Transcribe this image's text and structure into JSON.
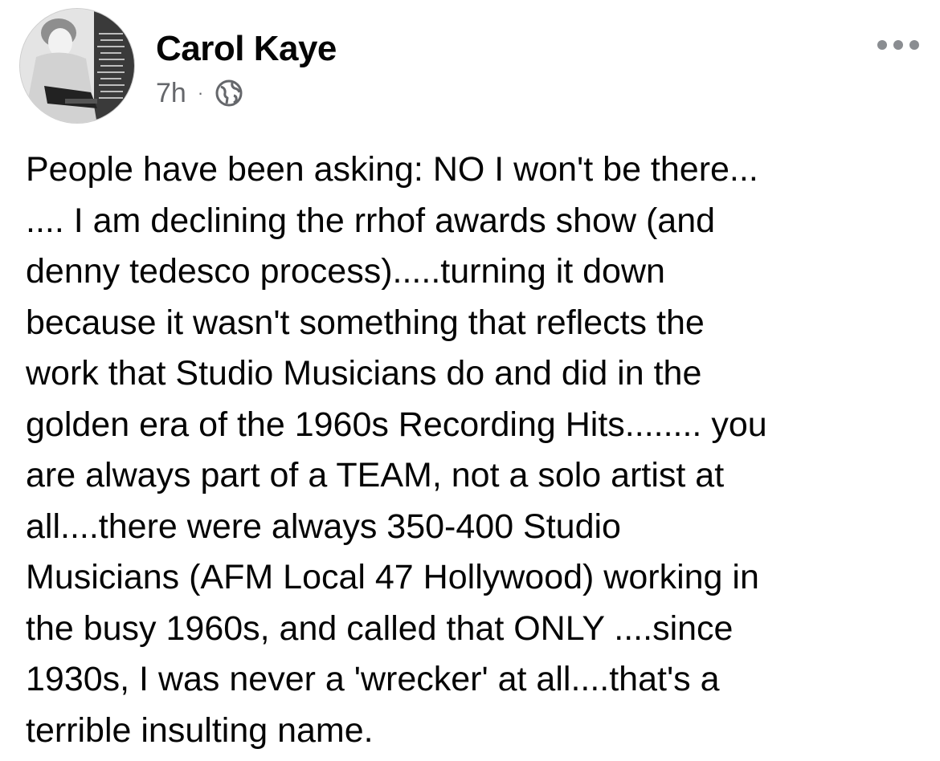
{
  "post": {
    "author": "Carol Kaye",
    "time": "7h",
    "separator": "·",
    "privacy_icon": "globe-icon",
    "menu_icon": "more-horizontal-icon",
    "text_lines": [
      "People have been asking:  NO I won't be there...",
      ".... I am declining the rrhof awards show (and",
      "denny tedesco process).....turning it down",
      "because it wasn't something that reflects the",
      "work that Studio Musicians do and did in the",
      "golden era of the 1960s Recording Hits........ you",
      "are always part of a TEAM, not a solo artist at",
      "all....there were always 350-400 Studio",
      "Musicians (AFM Local 47 Hollywood) working in",
      "the busy 1960s, and called that ONLY ....since",
      "1930s, I was never a 'wrecker' at all....that's a",
      "terrible insulting name."
    ]
  },
  "colors": {
    "text": "#050505",
    "secondary_text": "#65676b",
    "icon_gray": "#8a8d91",
    "background": "#ffffff"
  }
}
